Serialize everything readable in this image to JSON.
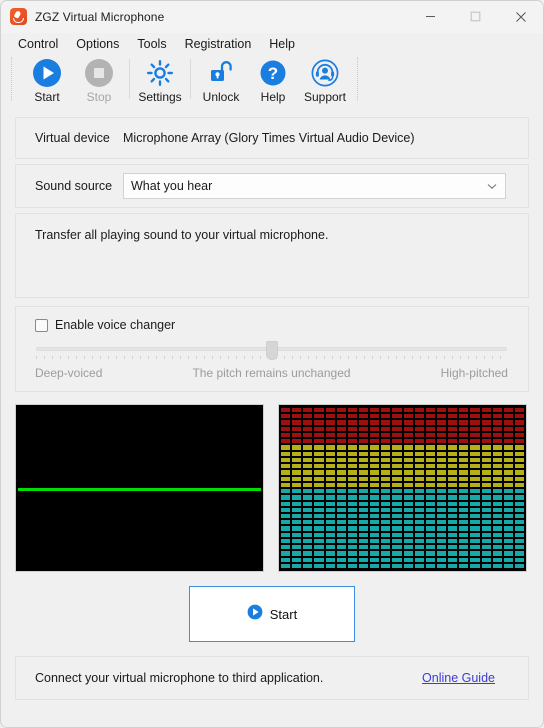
{
  "window": {
    "title": "ZGZ Virtual Microphone",
    "app_icon": "microphone-icon",
    "minimize": "minimize-icon",
    "maximize": "maximize-icon",
    "close": "close-icon"
  },
  "menubar": {
    "items": [
      {
        "label": "Control"
      },
      {
        "label": "Options"
      },
      {
        "label": "Tools"
      },
      {
        "label": "Registration"
      },
      {
        "label": "Help"
      }
    ]
  },
  "toolbar": {
    "buttons": [
      {
        "label": "Start",
        "icon": "play-circle-icon",
        "enabled": true
      },
      {
        "label": "Stop",
        "icon": "stop-circle-icon",
        "enabled": false
      },
      {
        "label": "Settings",
        "icon": "gear-icon",
        "enabled": true
      },
      {
        "label": "Unlock",
        "icon": "unlock-padlock-icon",
        "enabled": true
      },
      {
        "label": "Help",
        "icon": "question-circle-icon",
        "enabled": true
      },
      {
        "label": "Support",
        "icon": "headset-person-icon",
        "enabled": true
      }
    ]
  },
  "device_row": {
    "label": "Virtual device",
    "value": "Microphone Array (Glory Times Virtual Audio Device)"
  },
  "source_row": {
    "label": "Sound source",
    "value": "What you hear",
    "dropdown_icon": "chevron-down-icon"
  },
  "description": {
    "text": "Transfer all playing sound to your virtual microphone."
  },
  "voice_changer": {
    "checkbox_label": "Enable voice changer",
    "checked": false,
    "slider_value": 50,
    "slider_min_label": "Deep-voiced",
    "slider_mid_label": "The pitch remains unchanged",
    "slider_max_label": "High-pitched"
  },
  "visualizers": {
    "waveform": {
      "name": "waveform-display",
      "line_color": "#00dd00",
      "background": "#000000"
    },
    "spectrum": {
      "name": "spectrum-analyzer",
      "background": "#000000",
      "columns": 22,
      "rows": 26,
      "high_color": "#9e1010",
      "mid_color": "#b5b016",
      "low_color": "#17a8a8",
      "high_rows": 6,
      "mid_rows": 7
    }
  },
  "start_button": {
    "label": "Start",
    "icon": "play-circle-icon",
    "border_color": "#3c8fe0"
  },
  "footer": {
    "text": "Connect your virtual microphone to third application.",
    "link": "Online Guide",
    "link_color": "#3b3bd8"
  },
  "theme": {
    "accent": "#1a7ee0",
    "window_bg": "#f0f0f0",
    "panel_border": "#e2e2e2"
  }
}
